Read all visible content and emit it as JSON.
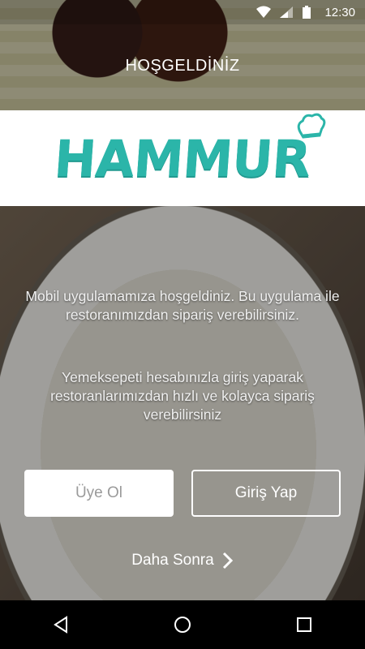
{
  "status_bar": {
    "time": "12:30"
  },
  "header": {
    "title": "HOŞGELDİNİZ"
  },
  "logo": {
    "text": "HAMMUR"
  },
  "messages": {
    "intro": "Mobil uygulamamıza hoşgeldiniz. Bu uygulama ile restoranımızdan sipariş verebilirsiniz.",
    "yemeksepeti": "Yemeksepeti hesabınızla giriş yaparak restoranlarımızdan hızlı ve kolayca sipariş verebilirsiniz"
  },
  "buttons": {
    "signup_label": "Üye Ol",
    "login_label": "Giriş Yap",
    "later_label": "Daha Sonra"
  },
  "colors": {
    "brand": "#2bb5a9"
  }
}
